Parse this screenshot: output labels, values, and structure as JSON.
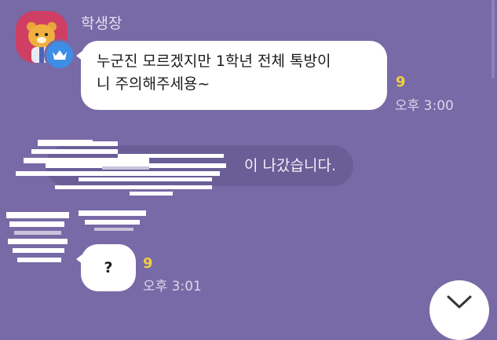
{
  "message1": {
    "sender": "학생장",
    "text_line1": "누군진 모르겠지만 1학년 전체 톡방이",
    "text_line2": "니 주의해주세용~",
    "unread": "9",
    "time": "오후 3:00"
  },
  "system_notice": {
    "text": "이 나갔습니다."
  },
  "message2": {
    "text": "?",
    "unread": "9",
    "time": "오후 3:01"
  },
  "icons": {
    "avatar1": "ryan-character-avatar",
    "host": "crown-icon",
    "scroll": "chevron-down-icon"
  },
  "colors": {
    "background": "#776aa6",
    "bubble": "#ffffff",
    "unread": "#f0d040",
    "host_badge": "#3d8ee6"
  }
}
